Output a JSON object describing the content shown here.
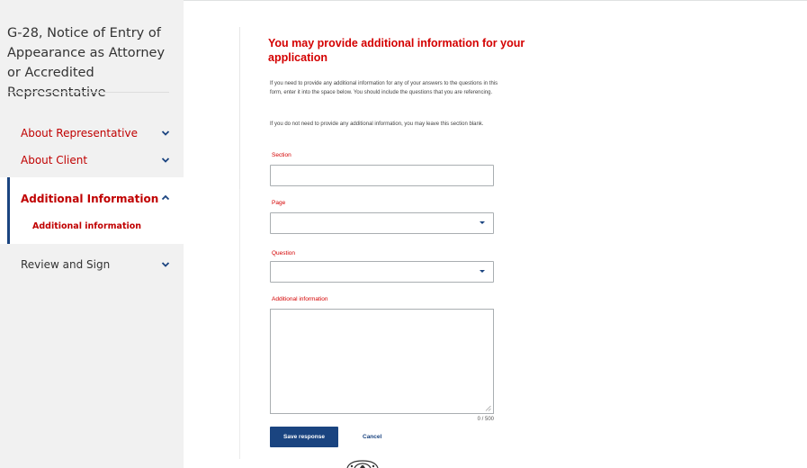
{
  "sidebar": {
    "form_title": "G-28, Notice of Entry of Appearance as Attorney or Accredited Representative",
    "items": [
      {
        "label": "About Representative",
        "icon": "chevron-down-icon"
      },
      {
        "label": "About Client",
        "icon": "chevron-down-icon"
      },
      {
        "label": "Additional Information",
        "icon": "chevron-up-icon",
        "active": true,
        "sub_items": [
          {
            "label": "Additional information",
            "active": true
          }
        ]
      },
      {
        "label": "Review and Sign",
        "icon": "chevron-down-icon"
      }
    ]
  },
  "main": {
    "heading": "You may provide additional information for your application",
    "paragraphs": [
      "If you need to provide any additional information for any of your answers to the questions in this form, enter it into the space below. You should include the questions that you are referencing.",
      "If you do not need to provide any additional information, you may leave this section blank."
    ],
    "fields": {
      "section": {
        "label": "Section",
        "value": ""
      },
      "page": {
        "label": "Page",
        "value": ""
      },
      "question": {
        "label": "Question",
        "value": ""
      },
      "additional_information": {
        "label": "Additional information",
        "value": ""
      }
    },
    "char_counter": "0 / 500",
    "save_label": "Save response",
    "cancel_label": "Cancel"
  },
  "colors": {
    "accent_red": "#d40000",
    "primary_blue": "#1a4480",
    "sidebar_bg": "#f1f1f1"
  }
}
